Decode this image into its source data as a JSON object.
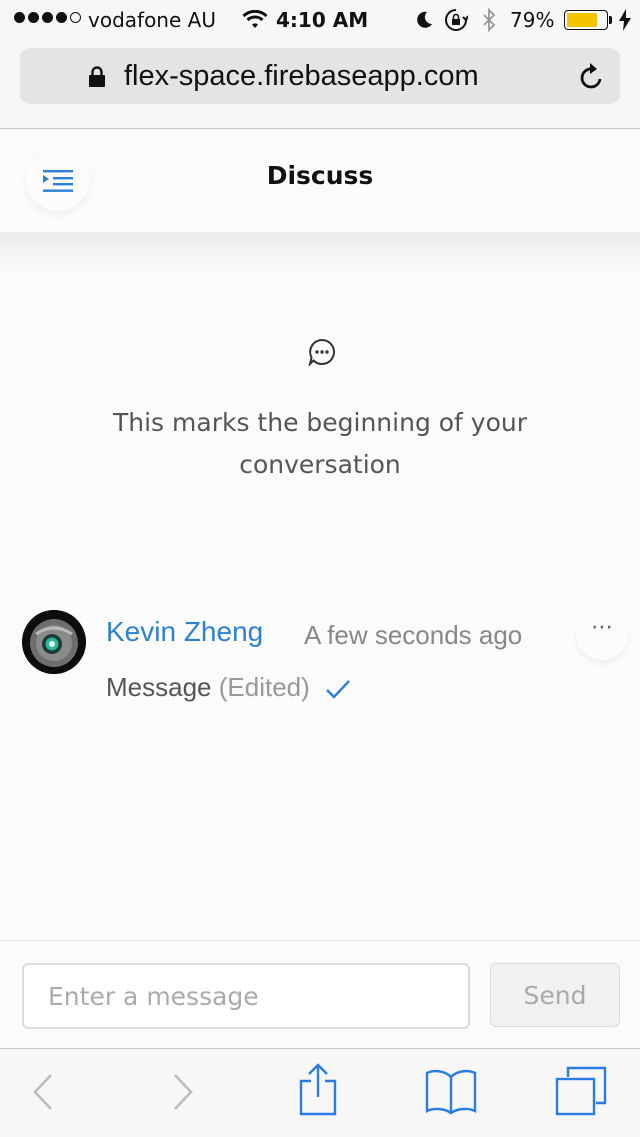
{
  "status_bar": {
    "carrier": "vodafone AU",
    "time": "4:10 AM",
    "battery": "79%",
    "battery_level": 0.79,
    "signal_bars_filled": 4,
    "signal_bars_total": 5
  },
  "browser": {
    "url": "flex-space.firebaseapp.com"
  },
  "header": {
    "title": "Discuss",
    "menu_icon": "menu-list-icon"
  },
  "empty_state": {
    "icon": "chat-bubble-icon",
    "text": "This marks the beginning of your conversation"
  },
  "message": {
    "author": "Kevin Zheng",
    "timestamp": "A few seconds ago",
    "text": "Message",
    "edited_label": "(Edited)",
    "more_label": "⋯"
  },
  "composer": {
    "placeholder": "Enter a message",
    "send_label": "Send"
  },
  "toolbar": {
    "icons": [
      "back-icon",
      "forward-icon",
      "share-icon",
      "bookmarks-icon",
      "tabs-icon"
    ]
  },
  "colors": {
    "accent": "#2e7fd6",
    "battery": "#f2c500",
    "toolbar_icon": "#2b7be6",
    "toolbar_icon_disabled": "#bcbcbc"
  }
}
